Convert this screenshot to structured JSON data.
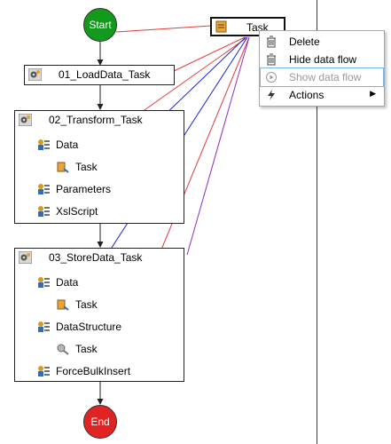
{
  "flow": {
    "start_label": "Start",
    "end_label": "End",
    "mini_task_label": "Task",
    "tasks": [
      {
        "label": "01_LoadData_Task"
      },
      {
        "label": "02_Transform_Task",
        "rows": [
          "Data",
          "Task",
          "Parameters",
          "XslScript"
        ]
      },
      {
        "label": "03_StoreData_Task",
        "rows": [
          "Data",
          "Task",
          "DataStructure",
          "Task",
          "ForceBulkInsert"
        ]
      }
    ]
  },
  "context_menu": {
    "items": [
      {
        "label": "Delete",
        "icon": "delete-icon",
        "enabled": true
      },
      {
        "label": "Hide data flow",
        "icon": "hide-data-flow-icon",
        "enabled": true
      },
      {
        "label": "Show data flow",
        "icon": "show-data-flow-icon",
        "enabled": false
      },
      {
        "label": "Actions",
        "icon": "lightning-icon",
        "enabled": true,
        "submenu": true
      }
    ]
  },
  "colors": {
    "start": "#139a1d",
    "end": "#e02424",
    "data_link": "#1a25d6",
    "control_link": "#e23b3b",
    "highlight_border": "#7ab5e3"
  }
}
